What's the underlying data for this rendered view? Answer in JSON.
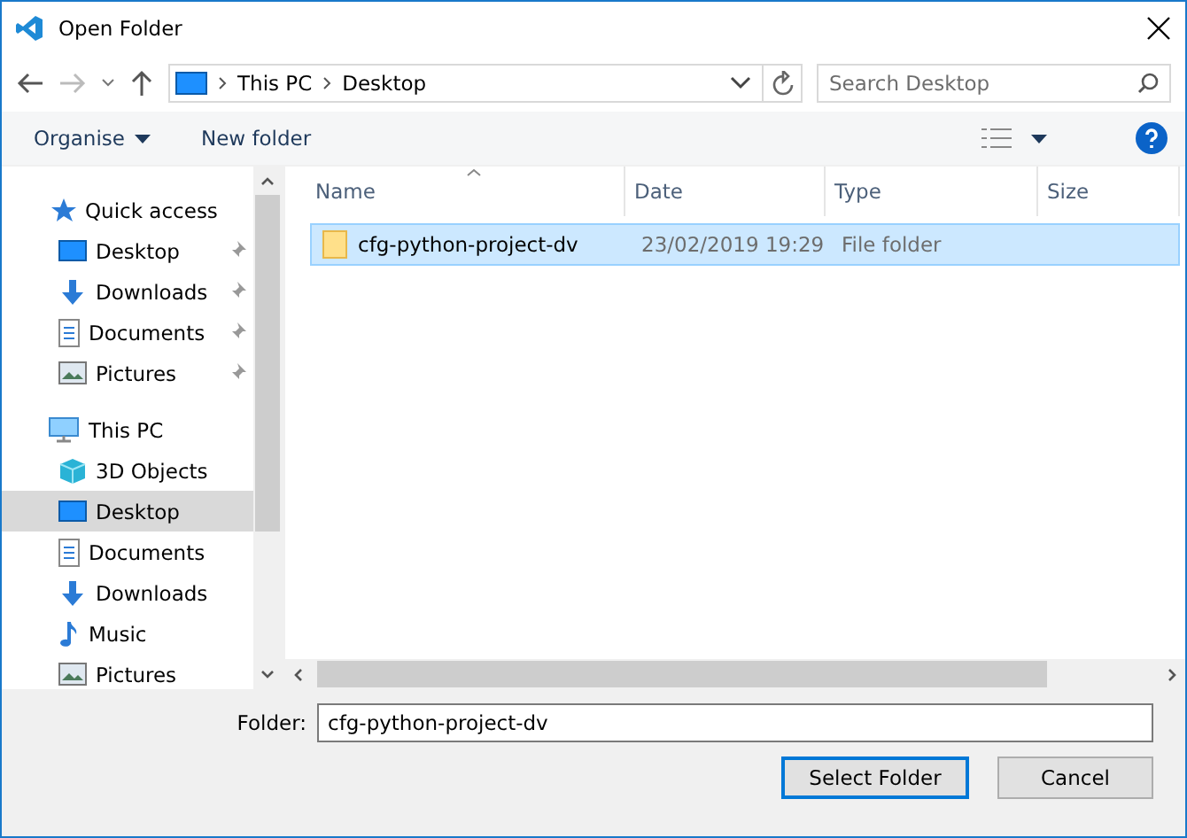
{
  "window": {
    "title": "Open Folder"
  },
  "address": {
    "crumbs": [
      "This PC",
      "Desktop"
    ]
  },
  "search": {
    "placeholder": "Search Desktop"
  },
  "toolbar": {
    "organise": "Organise",
    "new_folder": "New folder"
  },
  "sidebar": {
    "groups": [
      {
        "label": "Quick access",
        "kind": "star",
        "children": [
          {
            "label": "Desktop",
            "kind": "desktop",
            "pinned": true,
            "selected": false
          },
          {
            "label": "Downloads",
            "kind": "download",
            "pinned": true,
            "selected": false
          },
          {
            "label": "Documents",
            "kind": "document",
            "pinned": true,
            "selected": false
          },
          {
            "label": "Pictures",
            "kind": "picture",
            "pinned": true,
            "selected": false
          }
        ]
      },
      {
        "label": "This PC",
        "kind": "pc",
        "children": [
          {
            "label": "3D Objects",
            "kind": "cube",
            "pinned": false,
            "selected": false
          },
          {
            "label": "Desktop",
            "kind": "desktop",
            "pinned": false,
            "selected": true
          },
          {
            "label": "Documents",
            "kind": "document",
            "pinned": false,
            "selected": false
          },
          {
            "label": "Downloads",
            "kind": "download",
            "pinned": false,
            "selected": false
          },
          {
            "label": "Music",
            "kind": "music",
            "pinned": false,
            "selected": false
          },
          {
            "label": "Pictures",
            "kind": "picture",
            "pinned": false,
            "selected": false
          }
        ]
      }
    ]
  },
  "table": {
    "columns": [
      "Name",
      "Date",
      "Type",
      "Size"
    ],
    "rows": [
      {
        "name": "cfg-python-project-dv",
        "date": "23/02/2019 19:29",
        "type": "File folder",
        "selected": true
      }
    ]
  },
  "folder_field": {
    "label": "Folder:",
    "value": "cfg-python-project-dv"
  },
  "buttons": [
    "Select Folder",
    "Cancel"
  ]
}
